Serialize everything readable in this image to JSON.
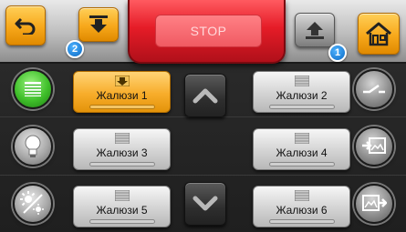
{
  "topbar": {
    "back_icon": "back-arrow-icon",
    "down_icon": "arrow-down-icon",
    "stop_label": "STOP",
    "up_icon": "arrow-up-icon",
    "home_icon": "home-icon",
    "badge_left": "2",
    "badge_right": "1"
  },
  "side_left": [
    {
      "icon": "blinds-icon",
      "state": "active"
    },
    {
      "icon": "bulb-icon",
      "state": "normal"
    },
    {
      "icon": "sun-dimmer-icon",
      "state": "normal"
    }
  ],
  "side_right": [
    {
      "icon": "switch-icon"
    },
    {
      "icon": "image-in-icon"
    },
    {
      "icon": "image-out-icon"
    }
  ],
  "blinds": [
    {
      "label": "Жалюзи 1",
      "active": true
    },
    {
      "label": "Жалюзи 2",
      "active": false
    },
    {
      "label": "Жалюзи 3",
      "active": false
    },
    {
      "label": "Жалюзи 4",
      "active": false
    },
    {
      "label": "Жалюзи 5",
      "active": false
    },
    {
      "label": "Жалюзи 6",
      "active": false
    }
  ],
  "colors": {
    "accent_orange": "#f7a81b",
    "stop_red": "#e51c27",
    "badge_blue": "#1e7fd6",
    "active_green": "#3fbf2a"
  }
}
